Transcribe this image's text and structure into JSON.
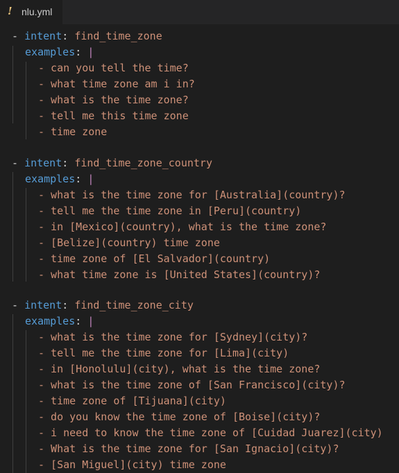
{
  "tab": {
    "icon": "!",
    "icon_name": "yaml-exclamation-icon",
    "filename": "nlu.yml"
  },
  "editor": {
    "blocks": [
      {
        "dash": "-",
        "intent_key": "intent",
        "intent_value": "find_time_zone",
        "examples_key": "examples",
        "pipe": "|",
        "examples": [
          "- can you tell the time?",
          "- what time zone am i in?",
          "- what is the time zone?",
          "- tell me this time zone",
          "- time zone"
        ]
      },
      {
        "dash": "-",
        "intent_key": "intent",
        "intent_value": "find_time_zone_country",
        "examples_key": "examples",
        "pipe": "|",
        "examples": [
          "- what is the time zone for [Australia](country)?",
          "- tell me the time zone in [Peru](country)",
          "- in [Mexico](country), what is the time zone?",
          "- [Belize](country) time zone",
          "- time zone of [El Salvador](country)",
          "- what time zone is [United States](country)?"
        ]
      },
      {
        "dash": "-",
        "intent_key": "intent",
        "intent_value": "find_time_zone_city",
        "examples_key": "examples",
        "pipe": "|",
        "examples": [
          "- what is the time zone for [Sydney](city)?",
          "- tell me the time zone for [Lima](city)",
          "- in [Honolulu](city), what is the time zone?",
          "- what is the time zone of [San Francisco](city)?",
          "- time zone of [Tijuana](city)",
          "- do you know the time zone of [Boise](city)?",
          "- i need to know the time zone of [Cuidad Juarez](city)",
          "- What is the time zone for [San Ignacio](city)?",
          "- [San Miguel](city) time zone"
        ]
      }
    ]
  },
  "colors": {
    "background": "#1e1e1e",
    "key": "#569cd6",
    "string": "#ce9178",
    "block_pipe": "#c586c0",
    "tab_icon": "#e5c07b"
  }
}
